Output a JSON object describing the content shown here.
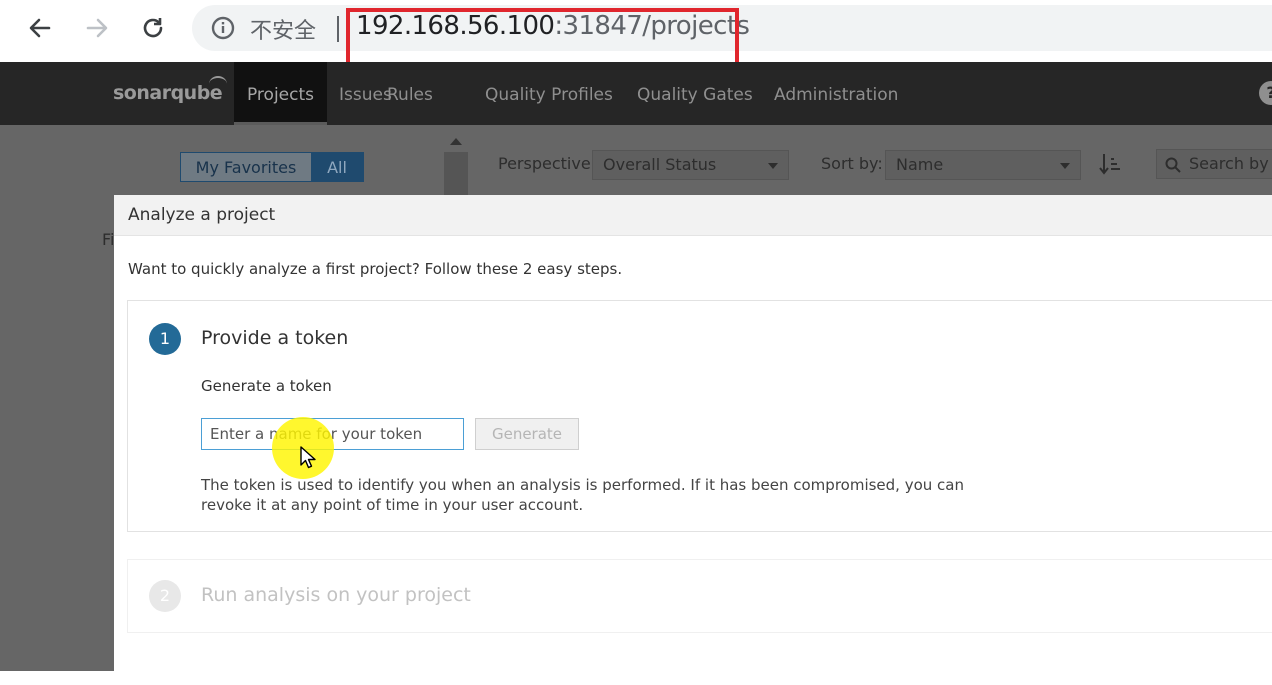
{
  "browser": {
    "security_label": "不安全",
    "url_host": "192.168.56.100",
    "url_rest": ":31847/projects"
  },
  "sonarqube": {
    "logo": "sonarqube",
    "nav": [
      "Projects",
      "Issues",
      "Rules",
      "Quality Profiles",
      "Quality Gates",
      "Administration"
    ],
    "active_nav": "Projects"
  },
  "projects_page": {
    "filter_my_favorites": "My Favorites",
    "filter_all": "All",
    "perspective_label": "Perspective:",
    "perspective_value": "Overall Status",
    "sort_label": "Sort by:",
    "sort_value": "Name",
    "search_placeholder": "Search by p",
    "partial_text": "Fi"
  },
  "modal": {
    "title": "Analyze a project",
    "intro": "Want to quickly analyze a first project? Follow these 2 easy steps.",
    "step1": {
      "number": "1",
      "title": "Provide a token",
      "generate_label": "Generate a token",
      "input_placeholder": "Enter a name for your token",
      "generate_button": "Generate",
      "help_line1": "The token is used to identify you when an analysis is performed. If it has been compromised, you can",
      "help_line2": "revoke it at any point of time in your user account."
    },
    "step2": {
      "number": "2",
      "title": "Run analysis on your project"
    }
  }
}
